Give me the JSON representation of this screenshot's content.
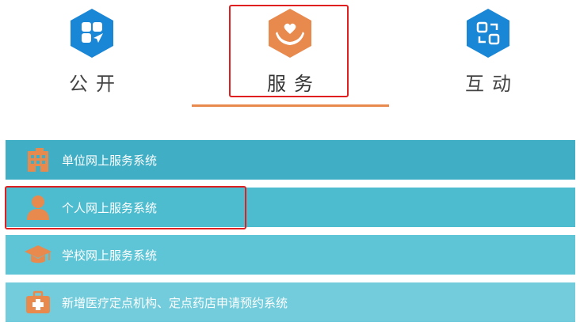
{
  "tabs": [
    {
      "id": "public",
      "label": "公开",
      "color": "#1a86d6",
      "icon": "gov-app-icon"
    },
    {
      "id": "service",
      "label": "服务",
      "color": "#e8894e",
      "icon": "heart-hands-icon",
      "active": true
    },
    {
      "id": "interact",
      "label": "互动",
      "color": "#1a86d6",
      "icon": "swap-icon"
    }
  ],
  "menu": {
    "items": [
      {
        "label": "单位网上服务系统",
        "icon": "building-icon"
      },
      {
        "label": "个人网上服务系统",
        "icon": "person-icon"
      },
      {
        "label": "学校网上服务系统",
        "icon": "graduation-cap-icon"
      },
      {
        "label": "新增医疗定点机构、定点药店申请预约系统",
        "icon": "medical-kit-icon"
      }
    ]
  },
  "colors": {
    "accent": "#e8894e",
    "highlight": "#e02020",
    "blue": "#1a86d6",
    "row_bg": [
      "#40afc6",
      "#4dbccf",
      "#5ec5d7",
      "#72ccdc"
    ]
  }
}
